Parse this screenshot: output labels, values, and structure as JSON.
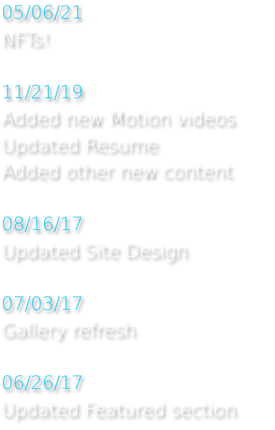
{
  "changelog": {
    "entries": [
      {
        "date": "05/06/21",
        "notes": [
          "NFTs!"
        ]
      },
      {
        "date": "11/21/19",
        "notes": [
          "Added new Motion videos",
          "Updated Resume",
          "Added other new content"
        ]
      },
      {
        "date": "08/16/17",
        "notes": [
          "Updated Site Design"
        ]
      },
      {
        "date": "07/03/17",
        "notes": [
          "Gallery refresh"
        ]
      },
      {
        "date": "06/26/17",
        "notes": [
          "Updated Featured section"
        ]
      }
    ]
  },
  "colors": {
    "date": "#1ec8ee",
    "note": "#ffffff",
    "shadow": "rgba(0,0,0,0.55)"
  }
}
